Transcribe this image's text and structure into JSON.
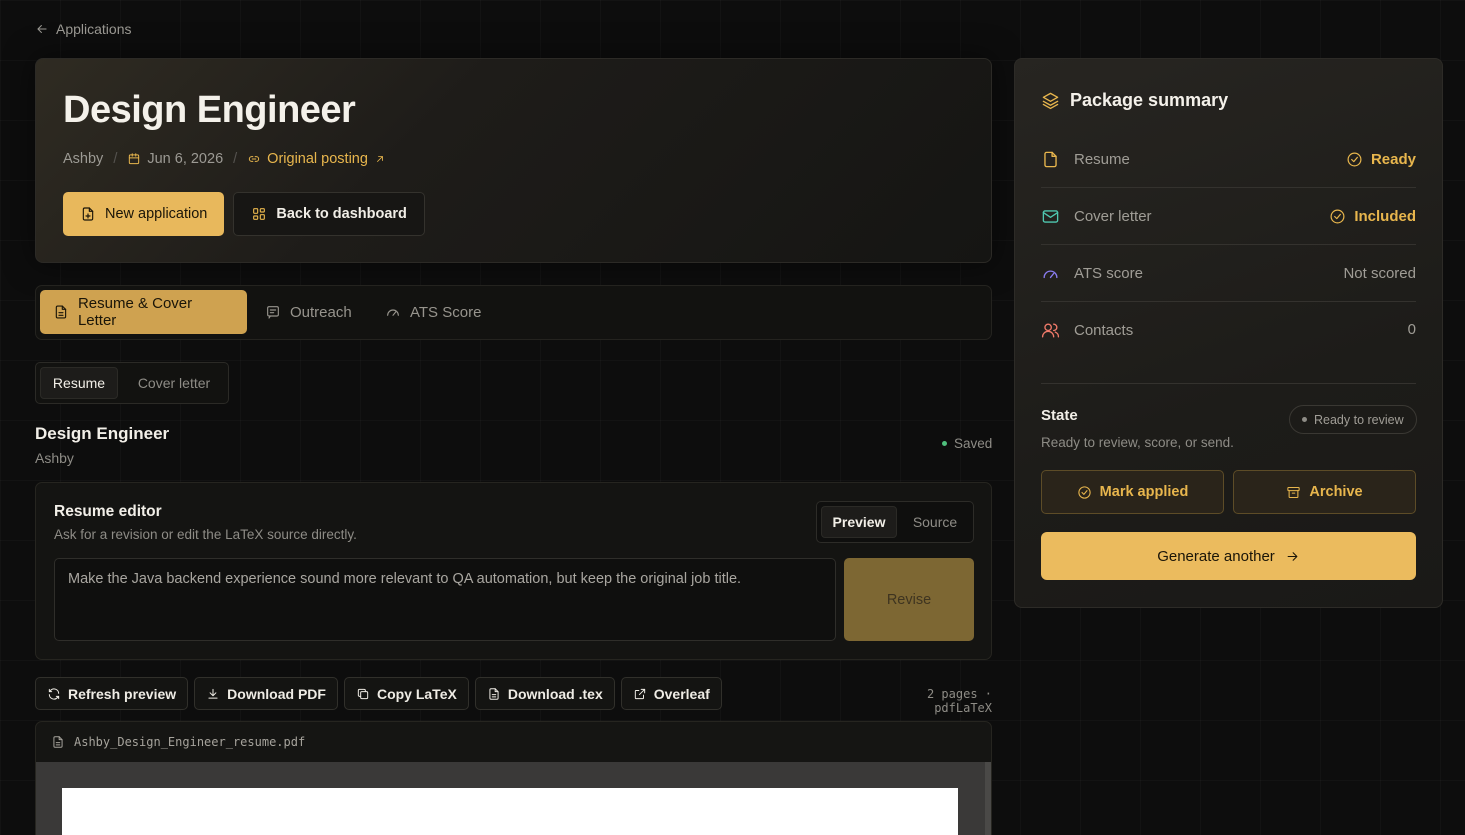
{
  "nav": {
    "back_label": "Applications"
  },
  "hero": {
    "title": "Design Engineer",
    "company": "Ashby",
    "date": "Jun 6, 2026",
    "posting_link": "Original posting",
    "new_application": "New application",
    "back_to_dashboard": "Back to dashboard"
  },
  "tabs": [
    {
      "label": "Resume & Cover Letter",
      "icon": "document-icon",
      "active": true
    },
    {
      "label": "Outreach",
      "icon": "message-icon",
      "active": false
    },
    {
      "label": "ATS Score",
      "icon": "gauge-icon",
      "active": false
    }
  ],
  "doc_toggle": {
    "resume": "Resume",
    "cover_letter": "Cover letter"
  },
  "document": {
    "title": "Design Engineer",
    "company": "Ashby",
    "status": "Saved"
  },
  "editor": {
    "title": "Resume editor",
    "subtitle": "Ask for a revision or edit the LaTeX source directly.",
    "preview": "Preview",
    "source": "Source",
    "prompt_text": "Make the Java backend experience sound more relevant to QA automation, but keep the original job title.",
    "revise": "Revise"
  },
  "actions": {
    "refresh": "Refresh preview",
    "download_pdf": "Download PDF",
    "copy_latex": "Copy LaTeX",
    "download_tex": "Download .tex",
    "overleaf": "Overleaf",
    "pages_info": "2 pages · pdfLaTeX"
  },
  "viewer": {
    "filename": "Ashby_Design_Engineer_resume.pdf"
  },
  "summary": {
    "title": "Package summary",
    "rows": [
      {
        "label": "Resume",
        "value": "Ready",
        "icon": "file-icon",
        "status_icon": "check-circle-icon"
      },
      {
        "label": "Cover letter",
        "value": "Included",
        "icon": "mail-icon",
        "status_icon": "check-circle-icon"
      },
      {
        "label": "ATS score",
        "value": "Not scored",
        "icon": "gauge-icon"
      },
      {
        "label": "Contacts",
        "value": "0",
        "icon": "users-icon"
      }
    ],
    "state_title": "State",
    "state_sub": "Ready to review, score, or send.",
    "state_badge": "Ready to review",
    "mark_applied": "Mark applied",
    "archive": "Archive",
    "generate": "Generate another"
  },
  "colors": {
    "accent": "#e8b85c",
    "accent_text": "#e8b64d",
    "success_dot": "#4fbf7d",
    "cover_icon": "#4fc7b0",
    "ats_icon": "#8a7cf0",
    "contacts_icon": "#ef7a6a",
    "resume_icon": "#e8b64d"
  }
}
